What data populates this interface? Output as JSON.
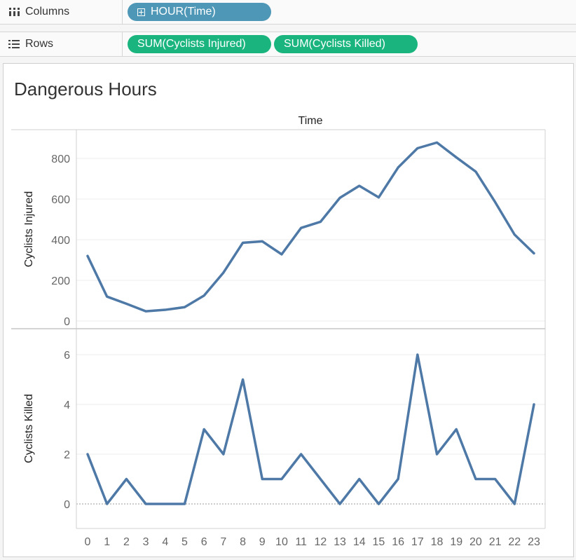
{
  "columns_shelf": {
    "label": "Columns",
    "pill": "HOUR(Time)"
  },
  "rows_shelf": {
    "label": "Rows",
    "pills": [
      "SUM(Cyclists Injured)",
      "SUM(Cyclists Killed)"
    ]
  },
  "sheet": {
    "title": "Dangerous Hours",
    "column_header": "Time"
  },
  "colors": {
    "line": "#4e79a7",
    "dimension_pill": "#4e97b7",
    "measure_pill": "#1ab57f"
  },
  "chart_data": [
    {
      "type": "line",
      "ylabel": "Cyclists Injured",
      "xlabel": "Time",
      "x": [
        0,
        1,
        2,
        3,
        4,
        5,
        6,
        7,
        8,
        9,
        10,
        11,
        12,
        13,
        14,
        15,
        16,
        17,
        18,
        19,
        20,
        21,
        22,
        23
      ],
      "values": [
        320,
        120,
        85,
        48,
        55,
        68,
        125,
        238,
        385,
        392,
        328,
        458,
        488,
        606,
        665,
        608,
        755,
        850,
        878,
        805,
        735,
        585,
        425,
        333
      ],
      "yticks": [
        0,
        200,
        400,
        600,
        800
      ],
      "ylim": [
        0,
        920
      ],
      "grid": true
    },
    {
      "type": "line",
      "ylabel": "Cyclists Killed",
      "xlabel": "Time",
      "x": [
        0,
        1,
        2,
        3,
        4,
        5,
        6,
        7,
        8,
        9,
        10,
        11,
        12,
        13,
        14,
        15,
        16,
        17,
        18,
        19,
        20,
        21,
        22,
        23
      ],
      "values": [
        2,
        0,
        1,
        0,
        0,
        0,
        3,
        2,
        5,
        1,
        1,
        2,
        1,
        0,
        1,
        0,
        1,
        6,
        2,
        3,
        1,
        1,
        0,
        4
      ],
      "yticks": [
        0,
        2,
        4,
        6
      ],
      "ylim": [
        -0.8,
        6.8
      ],
      "grid": true
    }
  ]
}
